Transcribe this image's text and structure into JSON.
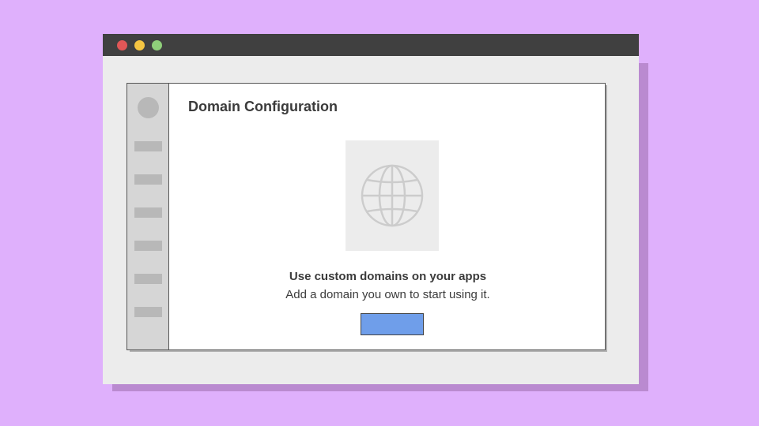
{
  "colors": {
    "backdrop": "#dfb0fc",
    "window_shadow": "#ba8ad0",
    "titlebar": "#404040",
    "close_light": "#e05757",
    "minimize_light": "#f5c542",
    "maximize_light": "#8fcf7a",
    "primary_button": "#6f9eea",
    "illustration_stroke": "#cccccc"
  },
  "main": {
    "title": "Domain Configuration",
    "empty_state": {
      "illustration_icon": "globe-icon",
      "heading": "Use custom domains on your apps",
      "subtext": "Add a domain you own to start using it.",
      "button_label": ""
    }
  },
  "sidebar": {
    "avatar_icon": "avatar",
    "items": [
      "",
      "",
      "",
      "",
      "",
      ""
    ]
  }
}
